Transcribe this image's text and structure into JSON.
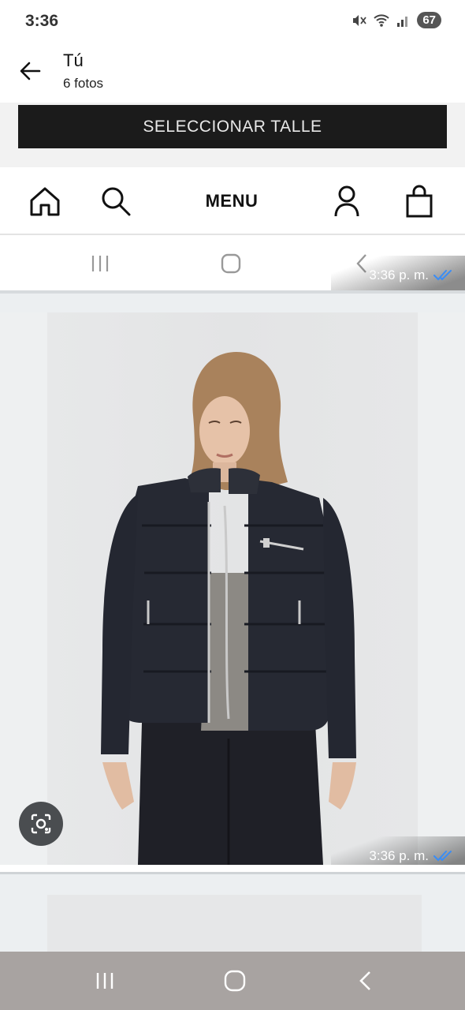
{
  "status_bar": {
    "time": "3:36",
    "battery": "67"
  },
  "header": {
    "title": "Tú",
    "subtitle": "6 fotos"
  },
  "screenshot_message": {
    "size_button_label": "SELECCIONAR TALLE",
    "menu_label": "MENU",
    "timestamp": "3:36 p. m."
  },
  "photo_message": {
    "timestamp": "3:36 p. m."
  },
  "colors": {
    "read_ticks": "#3b8df5",
    "button_dark": "#1b1b1b",
    "jacket": "#23262f"
  }
}
